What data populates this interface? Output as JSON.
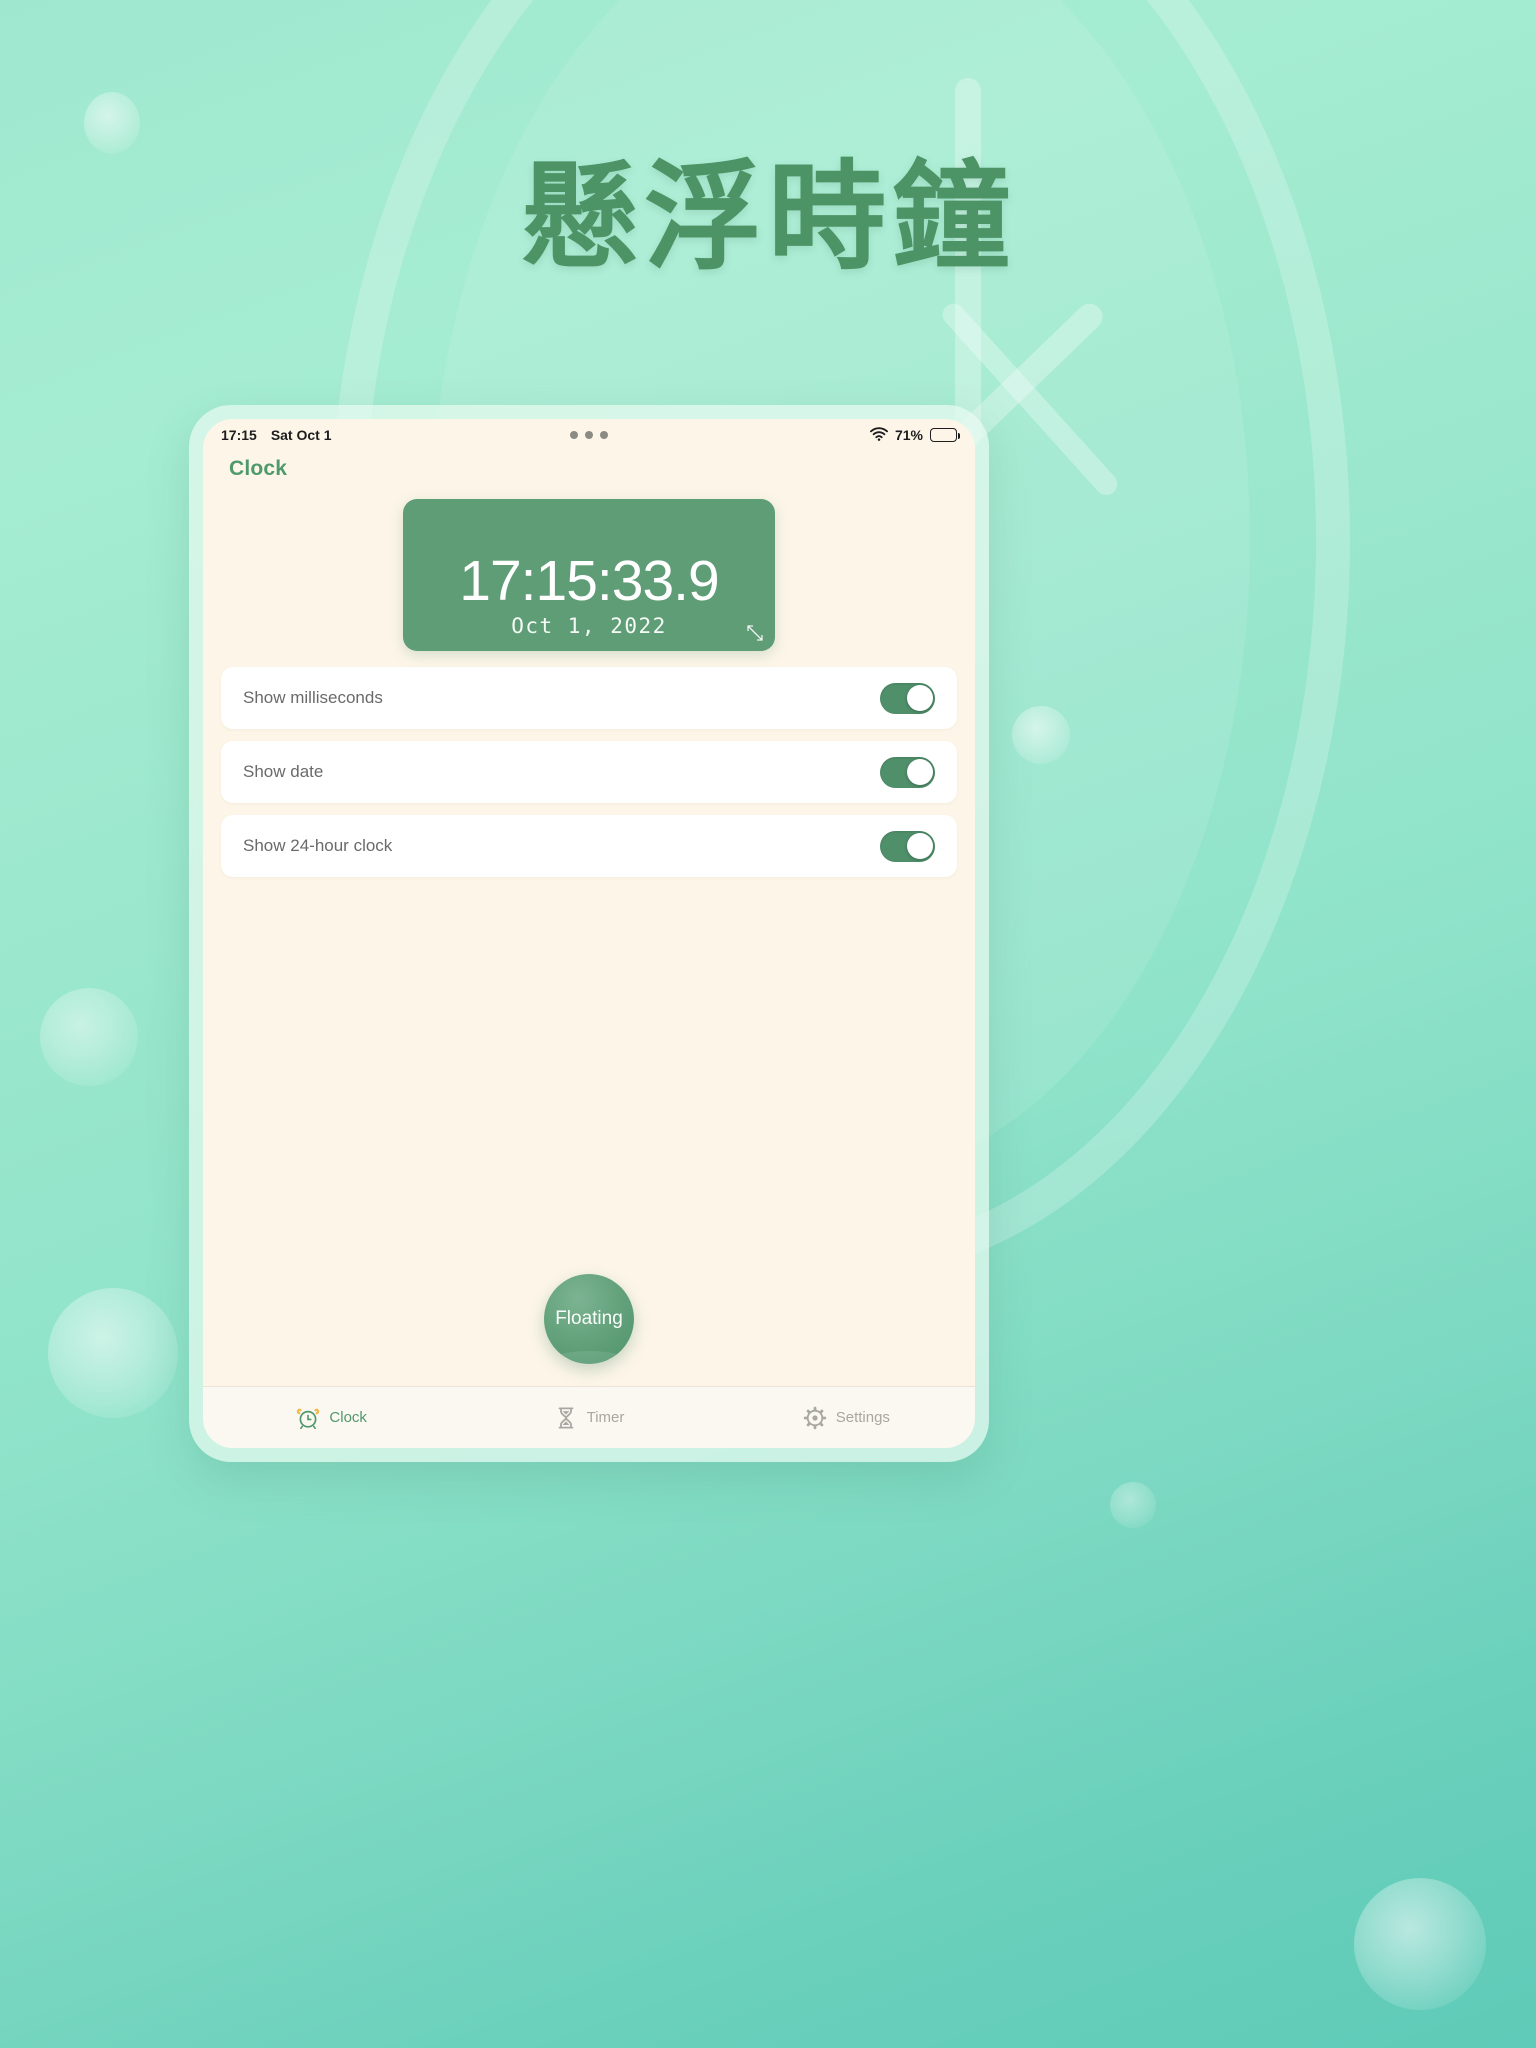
{
  "hero": {
    "title": "懸浮時鐘",
    "title_color": "#4c9466"
  },
  "theme": {
    "accent_green": "#5f9d76",
    "toggle_on": "#4f8f6a",
    "screen_bg": "#fdf6e8",
    "tab_active": "#51976c",
    "tab_inactive": "#a7a7a3",
    "page_bg_top": "#9fe8cf",
    "page_bg_bottom": "#5fcbb8"
  },
  "status_bar": {
    "time": "17:15",
    "date": "Sat Oct 1",
    "wifi_icon": "wifi-icon",
    "battery_percent": "71%",
    "battery_level": 71,
    "battery_icon": "battery-icon",
    "dots_icon": "camera-dots-icon"
  },
  "header": {
    "title": "Clock"
  },
  "clock_card": {
    "time": "17:15:33.9",
    "date": "Oct 1, 2022",
    "resize_icon": "resize-handle-icon"
  },
  "settings": {
    "rows": [
      {
        "label": "Show milliseconds",
        "toggle_name": "toggle-show-milliseconds",
        "on": true
      },
      {
        "label": "Show date",
        "toggle_name": "toggle-show-date",
        "on": true
      },
      {
        "label": "Show 24-hour clock",
        "toggle_name": "toggle-show-24-hour-clock",
        "on": true
      }
    ]
  },
  "floating_button": {
    "label": "Floating"
  },
  "tab_bar": {
    "items": [
      {
        "label": "Clock",
        "icon": "alarm-clock-icon",
        "active": true
      },
      {
        "label": "Timer",
        "icon": "hourglass-icon",
        "active": false
      },
      {
        "label": "Settings",
        "icon": "gear-icon",
        "active": false
      }
    ]
  }
}
